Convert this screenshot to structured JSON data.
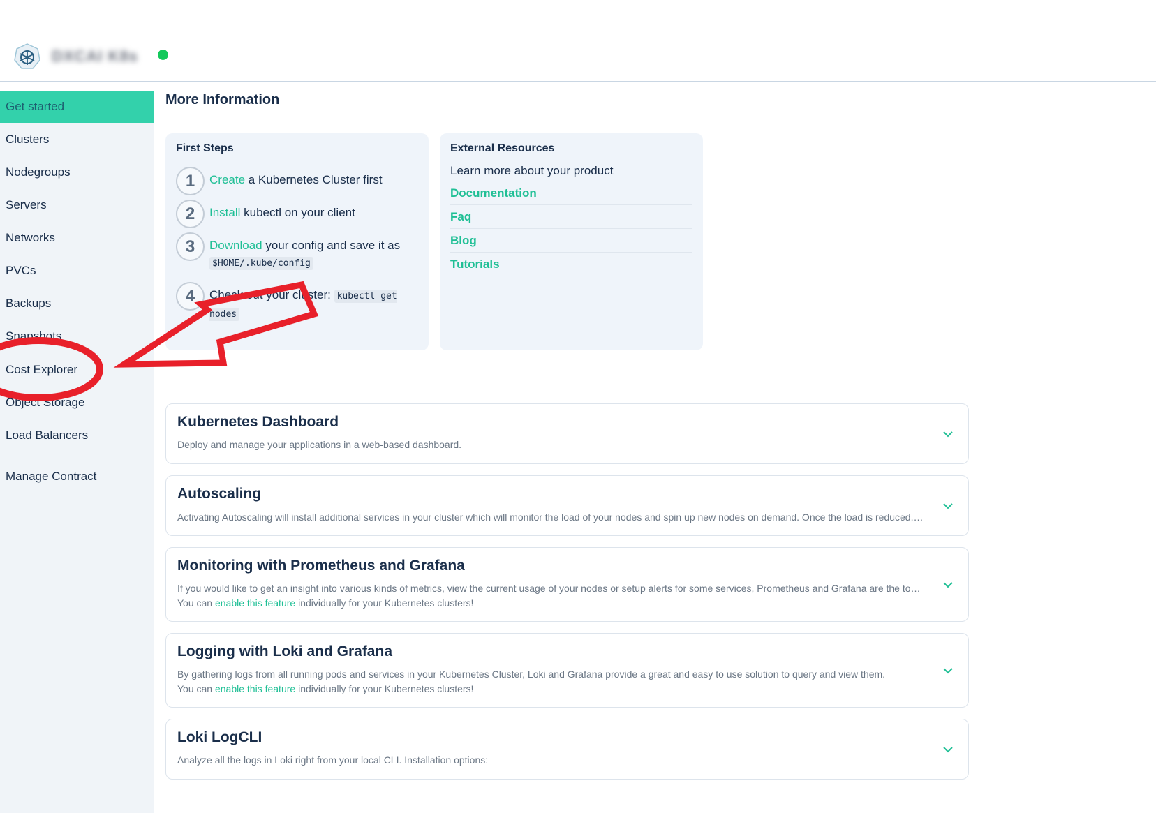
{
  "header": {
    "cluster_name": "DXCAI K8s",
    "status_color": "#14c95b"
  },
  "sidebar": {
    "items": [
      {
        "label": "Get started",
        "active": true
      },
      {
        "label": "Clusters"
      },
      {
        "label": "Nodegroups"
      },
      {
        "label": "Servers"
      },
      {
        "label": "Networks"
      },
      {
        "label": "PVCs"
      },
      {
        "label": "Backups"
      },
      {
        "label": "Snapshots"
      },
      {
        "label": "Cost Explorer"
      },
      {
        "label": "Object Storage"
      },
      {
        "label": "Load Balancers"
      },
      {
        "label": "Manage Contract"
      }
    ]
  },
  "main": {
    "title": "More Information",
    "first_steps": {
      "title": "First Steps",
      "steps": [
        {
          "num": "1",
          "link": "Create",
          "text": " a Kubernetes Cluster first"
        },
        {
          "num": "2",
          "link": "Install",
          "text": " kubectl on your client"
        },
        {
          "num": "3",
          "link": "Download",
          "text": " your config and save it as",
          "code": "$HOME/.kube/config"
        },
        {
          "num": "4",
          "text": "Check out your cluster: ",
          "code": "kubectl get nodes"
        }
      ]
    },
    "external": {
      "title": "External Resources",
      "subtitle": "Learn more about your product",
      "links": [
        "Documentation",
        "Faq",
        "Blog",
        "Tutorials"
      ]
    },
    "accordions": [
      {
        "title": "Kubernetes Dashboard",
        "desc": "Deploy and manage your applications in a web-based dashboard."
      },
      {
        "title": "Autoscaling",
        "desc": "Activating Autoscaling will install additional services in your cluster which will monitor the load of your nodes and spin up new nodes on demand. Once the load is reduced, unneeded nodes will be removed again."
      },
      {
        "title": "Monitoring with Prometheus and Grafana",
        "desc": "If you would like to get an insight into various kinds of metrics, view the current usage of your nodes or setup alerts for some services, Prometheus and Grafana are the tools of choice.",
        "desc2_prefix": "You can ",
        "desc2_link": "enable this feature",
        "desc2_suffix": " individually for your Kubernetes clusters!"
      },
      {
        "title": "Logging with Loki and Grafana",
        "desc": "By gathering logs from all running pods and services in your Kubernetes Cluster, Loki and Grafana provide a great and easy to use solution to query and view them.",
        "desc2_prefix": "You can ",
        "desc2_link": "enable this feature",
        "desc2_suffix": " individually for your Kubernetes clusters!"
      },
      {
        "title": "Loki LogCLI",
        "desc": "Analyze all the logs in Loki right from your local CLI. Installation options:"
      }
    ]
  },
  "colors": {
    "accent": "#1fbf95",
    "active_nav": "#33d1ab",
    "annotation": "#e8202a"
  }
}
